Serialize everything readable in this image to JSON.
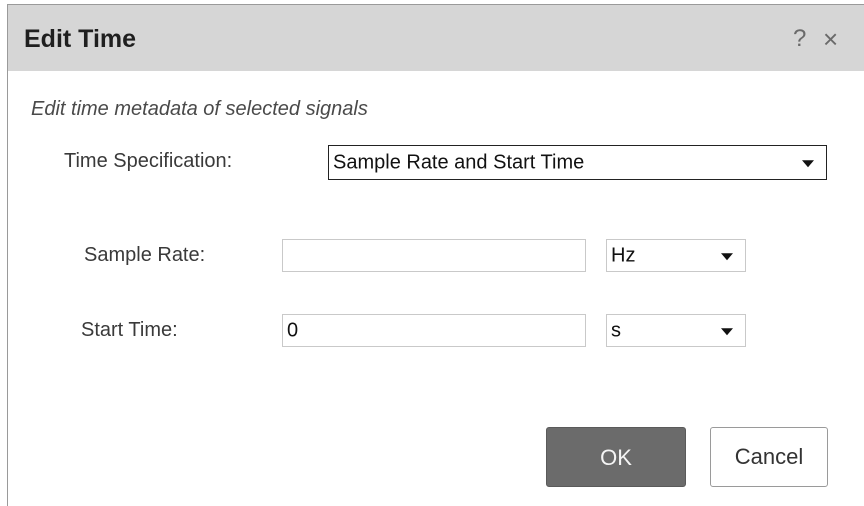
{
  "dialog": {
    "title": "Edit Time",
    "help_icon": "?",
    "close_icon": "×",
    "subtitle": "Edit time metadata of selected signals"
  },
  "time_specification": {
    "label": "Time Specification:",
    "value": "Sample Rate and Start Time"
  },
  "sample_rate": {
    "label": "Sample Rate:",
    "value": "",
    "unit": "Hz"
  },
  "start_time": {
    "label": "Start Time:",
    "value": "0",
    "unit": "s"
  },
  "buttons": {
    "ok": "OK",
    "cancel": "Cancel"
  },
  "icons": {
    "help": "help-icon",
    "close": "close-icon",
    "dropdown": "chevron-down-icon"
  }
}
